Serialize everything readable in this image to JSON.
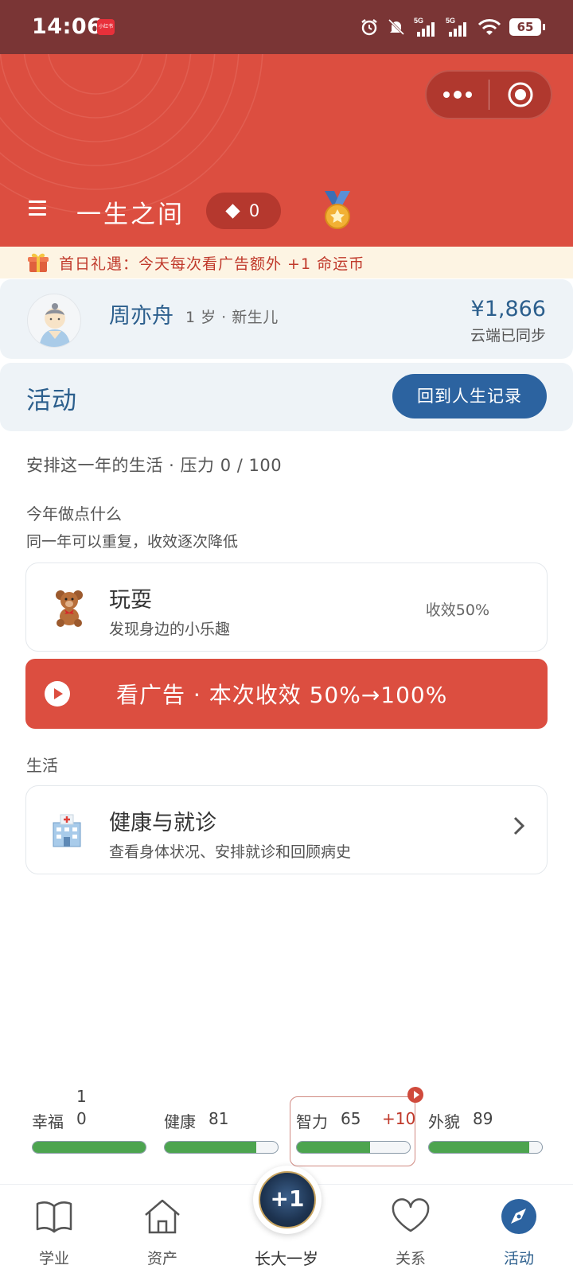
{
  "status_bar": {
    "time": "14:06",
    "notification_badge": "小红书",
    "battery": "65"
  },
  "header": {
    "app_title": "一生之间",
    "coins": "0"
  },
  "gift_banner": {
    "text": "首日礼遇：今天每次看广告额外 +1 命运币"
  },
  "profile": {
    "name": "周亦舟",
    "meta": "1 岁 · 新生儿",
    "money": "¥1,866",
    "sync_status": "云端已同步"
  },
  "activity": {
    "title": "活动",
    "back_button": "回到人生记录",
    "schedule_text": "安排这一年的生活 · 压力 0 / 100",
    "do_title": "今年做点什么",
    "do_subtitle": "同一年可以重复，收效逐次降低",
    "play_card": {
      "title": "玩耍",
      "desc": "发现身边的小乐趣",
      "yield": "收效50%"
    },
    "ad_button": "看广告 · 本次收效 50%→100%",
    "life_label": "生活",
    "health_card": {
      "title": "健康与就诊",
      "desc": "查看身体状况、安排就诊和回顾病史"
    }
  },
  "stats": {
    "happiness": {
      "label": "幸福",
      "value_top": "1",
      "value": "0",
      "level": 100
    },
    "health": {
      "label": "健康",
      "value": "81",
      "level": 81
    },
    "intelligence": {
      "label": "智力",
      "value": "65",
      "delta": "+10",
      "level": 65
    },
    "looks": {
      "label": "外貌",
      "value": "89",
      "level": 89
    }
  },
  "bottom_nav": {
    "study": "学业",
    "assets": "资产",
    "grow_button": "+1",
    "grow_label": "长大一岁",
    "relations": "关系",
    "activity": "活动"
  },
  "colors": {
    "header_red": "#dc4e40",
    "status_bar": "#7a3535",
    "primary_blue": "#2c63a0",
    "progress_green": "#4ca44f"
  },
  "icons": [
    "alarm-icon",
    "mute-bell-icon",
    "signal-5g-icon",
    "wifi-icon",
    "menu-icon",
    "diamond-icon",
    "medal-icon",
    "gift-icon",
    "teddy-bear-icon",
    "play-icon",
    "hospital-icon",
    "chevron-right-icon",
    "book-icon",
    "house-icon",
    "heart-icon",
    "compass-icon"
  ]
}
